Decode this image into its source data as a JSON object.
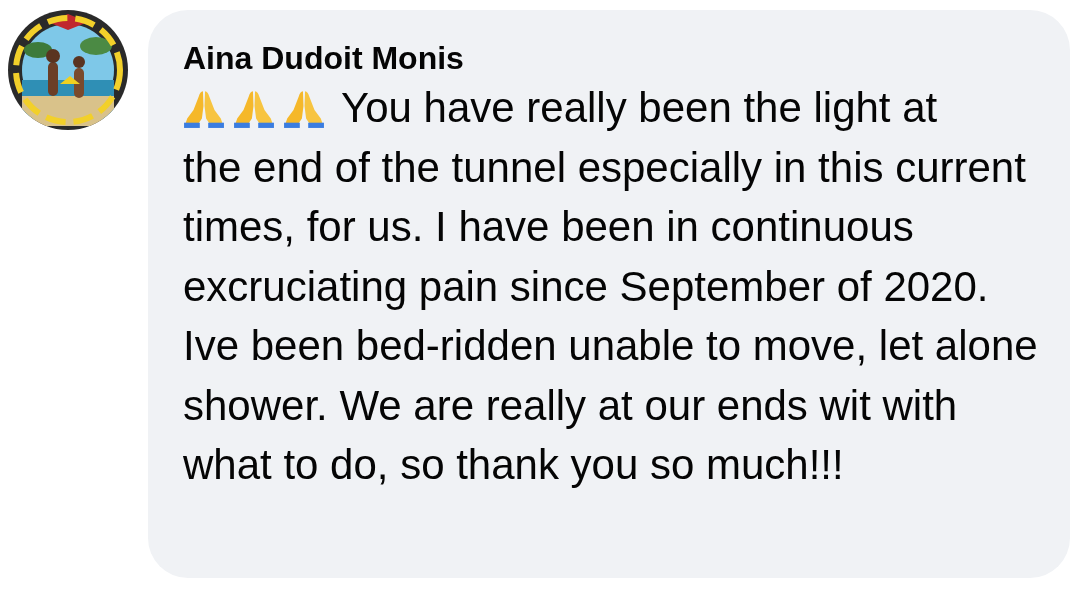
{
  "comment": {
    "author": "Aina Dudoit Monis",
    "text_lead": "You have really been the light at",
    "text": "the end of the tunnel especially in this current times, for us. I have been in continuous excruciating pain since September of 2020. Ive been bed-ridden unable to move, let alone shower. We are really at our ends wit with what to do, so thank you so much!!!"
  }
}
